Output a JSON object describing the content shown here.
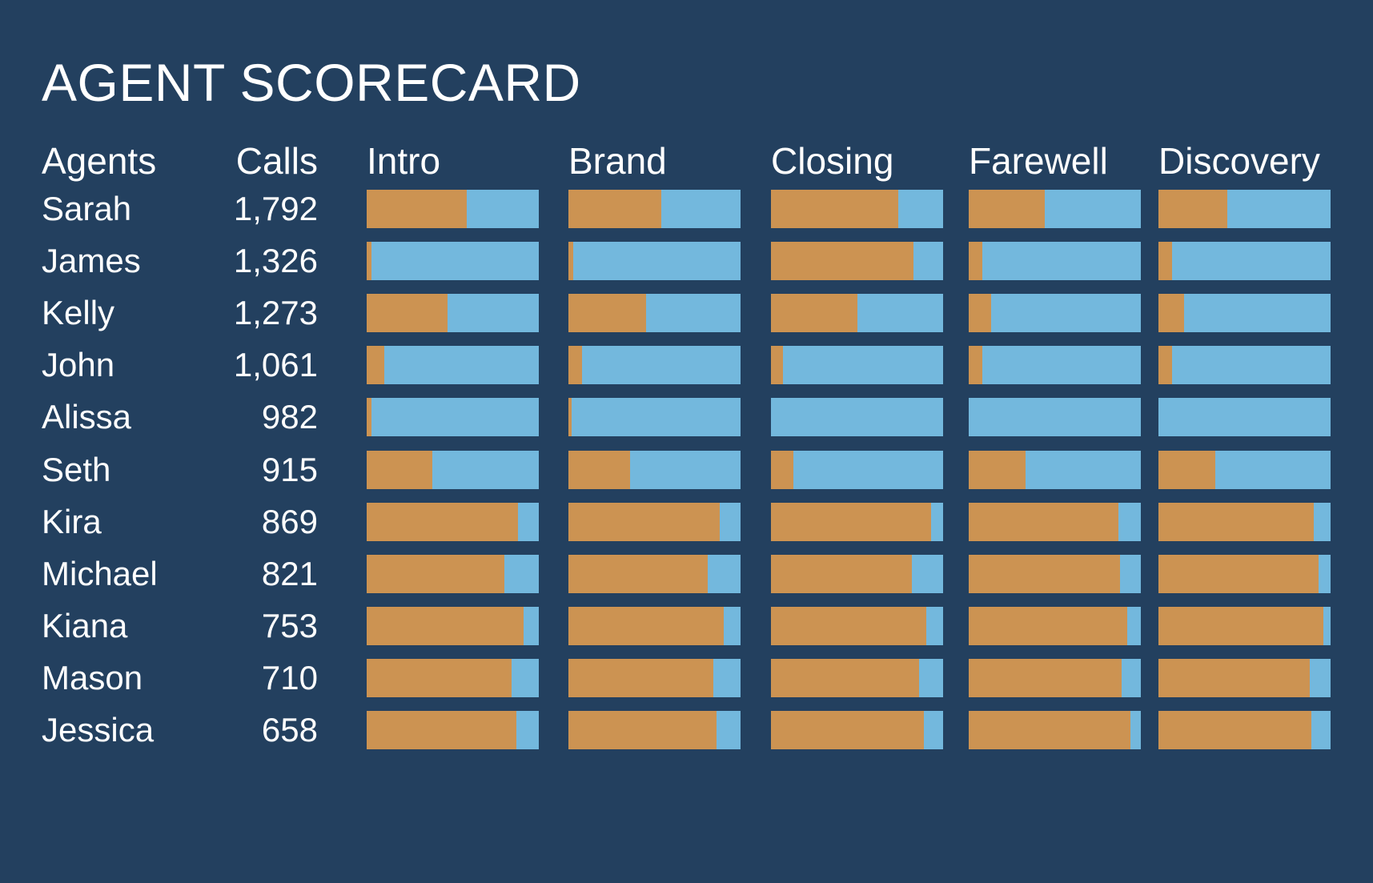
{
  "header": {
    "title": "AGENT SCORECARD"
  },
  "columns": {
    "agents_label": "Agents",
    "calls_label": "Calls",
    "metrics": [
      "Intro",
      "Brand",
      "Closing",
      "Farewell",
      "Discovery"
    ]
  },
  "colors": {
    "background": "#23405F",
    "filled": "#CC9352",
    "remainder": "#73B8DD",
    "text": "#FFFFFF"
  },
  "rows": [
    {
      "agent": "Sarah",
      "calls": "1,792",
      "values": [
        58,
        54,
        74,
        44,
        40
      ]
    },
    {
      "agent": "James",
      "calls": "1,326",
      "values": [
        3,
        3,
        83,
        8,
        8
      ]
    },
    {
      "agent": "Kelly",
      "calls": "1,273",
      "values": [
        47,
        45,
        50,
        13,
        15
      ]
    },
    {
      "agent": "John",
      "calls": "1,061",
      "values": [
        10,
        8,
        7,
        8,
        8
      ]
    },
    {
      "agent": "Alissa",
      "calls": "982",
      "values": [
        3,
        2,
        0,
        0,
        0
      ]
    },
    {
      "agent": "Seth",
      "calls": "915",
      "values": [
        38,
        36,
        13,
        33,
        33
      ]
    },
    {
      "agent": "Kira",
      "calls": "869",
      "values": [
        88,
        88,
        93,
        87,
        90
      ]
    },
    {
      "agent": "Michael",
      "calls": "821",
      "values": [
        80,
        81,
        82,
        88,
        93
      ]
    },
    {
      "agent": "Kiana",
      "calls": "753",
      "values": [
        91,
        90,
        90,
        92,
        96
      ]
    },
    {
      "agent": "Mason",
      "calls": "710",
      "values": [
        84,
        84,
        86,
        89,
        88
      ]
    },
    {
      "agent": "Jessica",
      "calls": "658",
      "values": [
        87,
        86,
        89,
        94,
        89
      ]
    }
  ],
  "chart_data": {
    "type": "bar",
    "title": "AGENT SCORECARD",
    "subtitle": "",
    "orientation": "horizontal-stacked-100",
    "xlabel": "",
    "ylabel": "",
    "xlim": [
      0,
      100
    ],
    "grid": false,
    "legend": "none",
    "categories": [
      "Sarah",
      "James",
      "Kelly",
      "John",
      "Alissa",
      "Seth",
      "Kira",
      "Michael",
      "Kiana",
      "Mason",
      "Jessica"
    ],
    "calls": [
      1792,
      1326,
      1273,
      1061,
      982,
      915,
      869,
      821,
      753,
      710,
      658
    ],
    "series": [
      {
        "name": "Intro",
        "values": [
          58,
          3,
          47,
          10,
          3,
          38,
          88,
          80,
          91,
          84,
          87
        ]
      },
      {
        "name": "Brand",
        "values": [
          54,
          3,
          45,
          8,
          2,
          36,
          88,
          81,
          90,
          84,
          86
        ]
      },
      {
        "name": "Closing",
        "values": [
          74,
          83,
          50,
          7,
          0,
          13,
          93,
          82,
          90,
          86,
          89
        ]
      },
      {
        "name": "Farewell",
        "values": [
          44,
          8,
          13,
          8,
          0,
          33,
          87,
          88,
          92,
          89,
          94
        ]
      },
      {
        "name": "Discovery",
        "values": [
          40,
          8,
          15,
          8,
          0,
          33,
          90,
          93,
          96,
          88,
          89
        ]
      }
    ],
    "value_units": "percent of calls with element present",
    "segment_colors": {
      "filled": "#CC9352",
      "remainder": "#73B8DD"
    }
  }
}
